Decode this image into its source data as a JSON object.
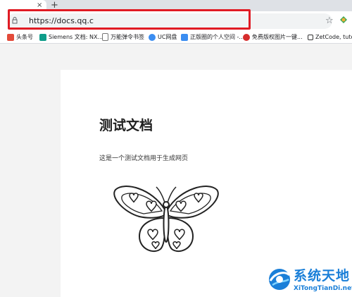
{
  "browser": {
    "new_tab_label": "+",
    "tab_close": "×",
    "url": "https://docs.qq.c",
    "star_icon": "star-icon"
  },
  "bookmarks": [
    {
      "label": "头条号",
      "color": "#e34b3a"
    },
    {
      "label": "Siemens 文档: NX...",
      "color": "#0f9d8a"
    },
    {
      "label": "万能弹令书签",
      "color": "#ffffff"
    },
    {
      "label": "UC网盘",
      "color": "#3b8df1"
    },
    {
      "label": "正版圈的个人空间 -...",
      "color": "#3b8df1"
    },
    {
      "label": "免费版权图片一键...",
      "color": "#d62d2d"
    },
    {
      "label": "ZetCode, tutori",
      "color": "#333333"
    }
  ],
  "document": {
    "title": "测试文档",
    "body": "这是一个测试文档用于生成网页"
  },
  "watermark": {
    "title": "系统天地",
    "subtitle": "XiTongTianDi.net"
  },
  "colors": {
    "highlight": "#e01b24",
    "watermark": "#1a7fd8"
  }
}
